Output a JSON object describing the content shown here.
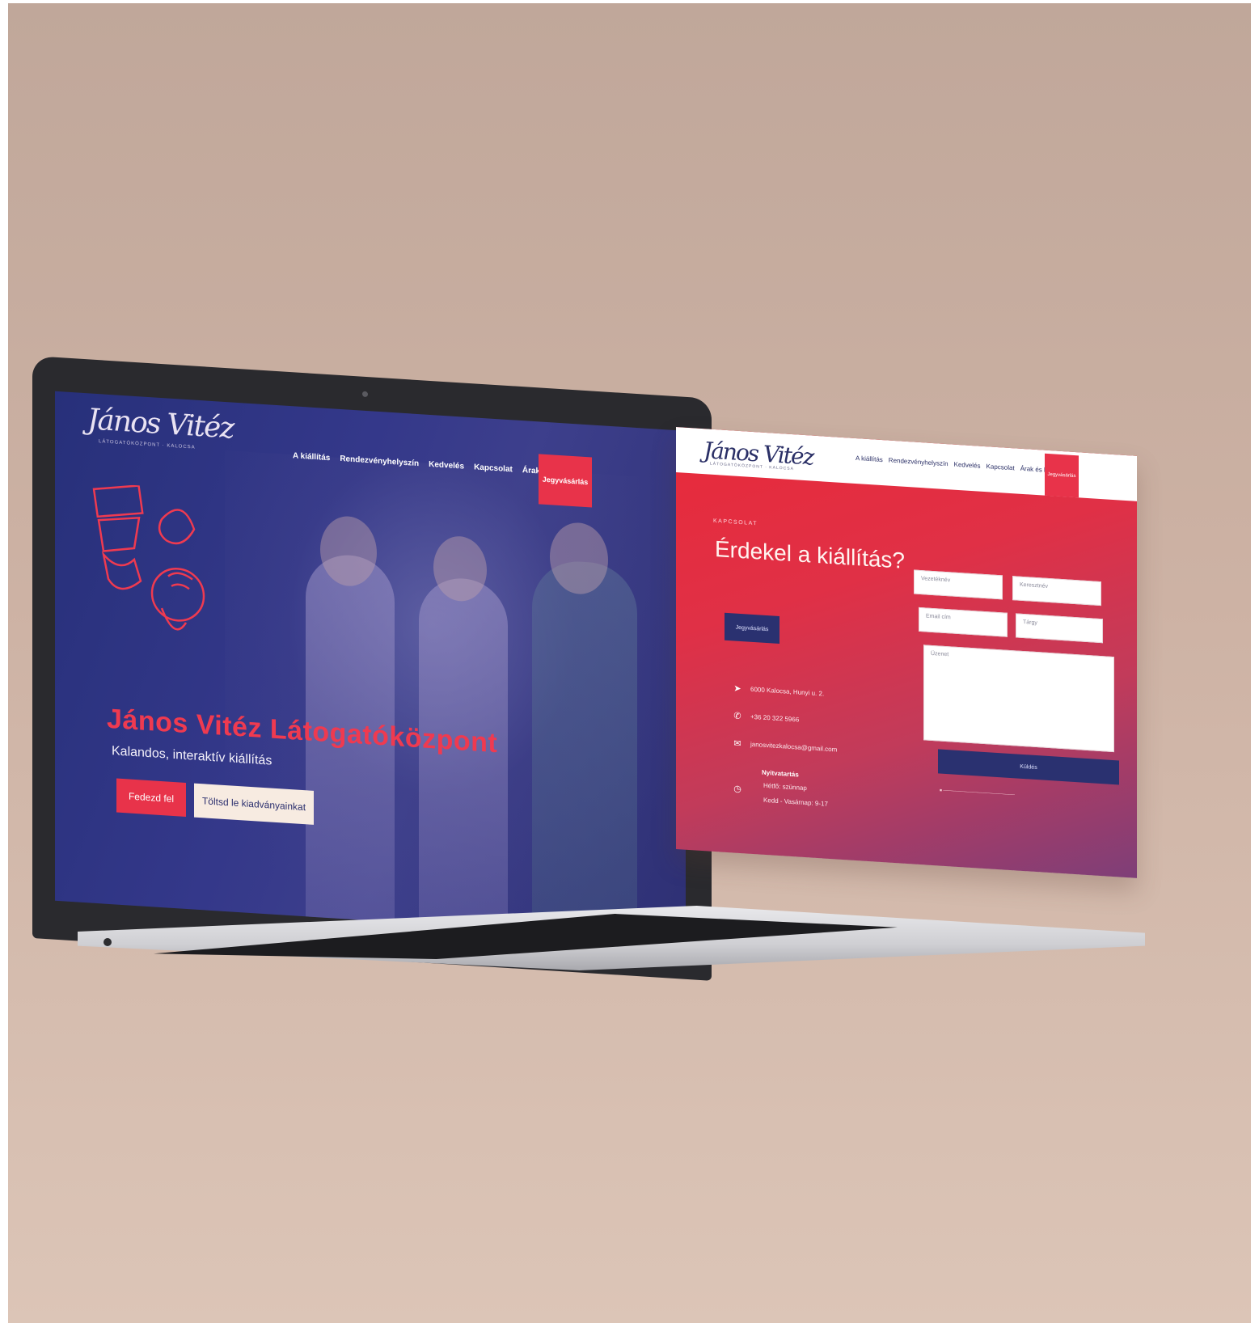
{
  "laptop": {
    "logo": "János Vitéz",
    "nav": [
      "A kiállítás",
      "Rendezvényhelyszín",
      "Kedvelés",
      "Kapcsolat",
      "Árak és látogatás"
    ],
    "cta": "Jegyvásárlás",
    "hero_title": "János Vitéz Látogatóközpont",
    "hero_subtitle": "Kalandos, interaktív kiállítás",
    "primary_button": "Fedezd fel",
    "secondary_button": "Töltsd le kiadványainkat"
  },
  "contact_page": {
    "logo": "János Vitéz",
    "nav": [
      "A kiállítás",
      "Rendezvényhelyszín",
      "Kedvelés",
      "Kapcsolat",
      "Árak és látogatás"
    ],
    "cta": "Jegyvásárlás",
    "eyebrow": "KAPCSOLAT",
    "title": "Érdekel a kiállítás?",
    "button": "Jegyvásárlás",
    "address": "6000 Kalocsa, Hunyi u. 2.",
    "phone": "+36 20 322 5966",
    "email": "janosvitezkalocsa@gmail.com",
    "hours_title": "Nyitvatartás",
    "hours_line1": "Hétfő: szünnap",
    "hours_line2": "Kedd - Vasárnap: 9-17",
    "form": {
      "last_name": "Vezetéknév",
      "first_name": "Keresztnév",
      "email": "Email cím",
      "subject": "Tárgy",
      "message": "Üzenet",
      "submit": "Küldés"
    }
  },
  "colors": {
    "brand_red": "#e8334a",
    "brand_navy": "#2a3170",
    "background": "#cdb2a4"
  }
}
